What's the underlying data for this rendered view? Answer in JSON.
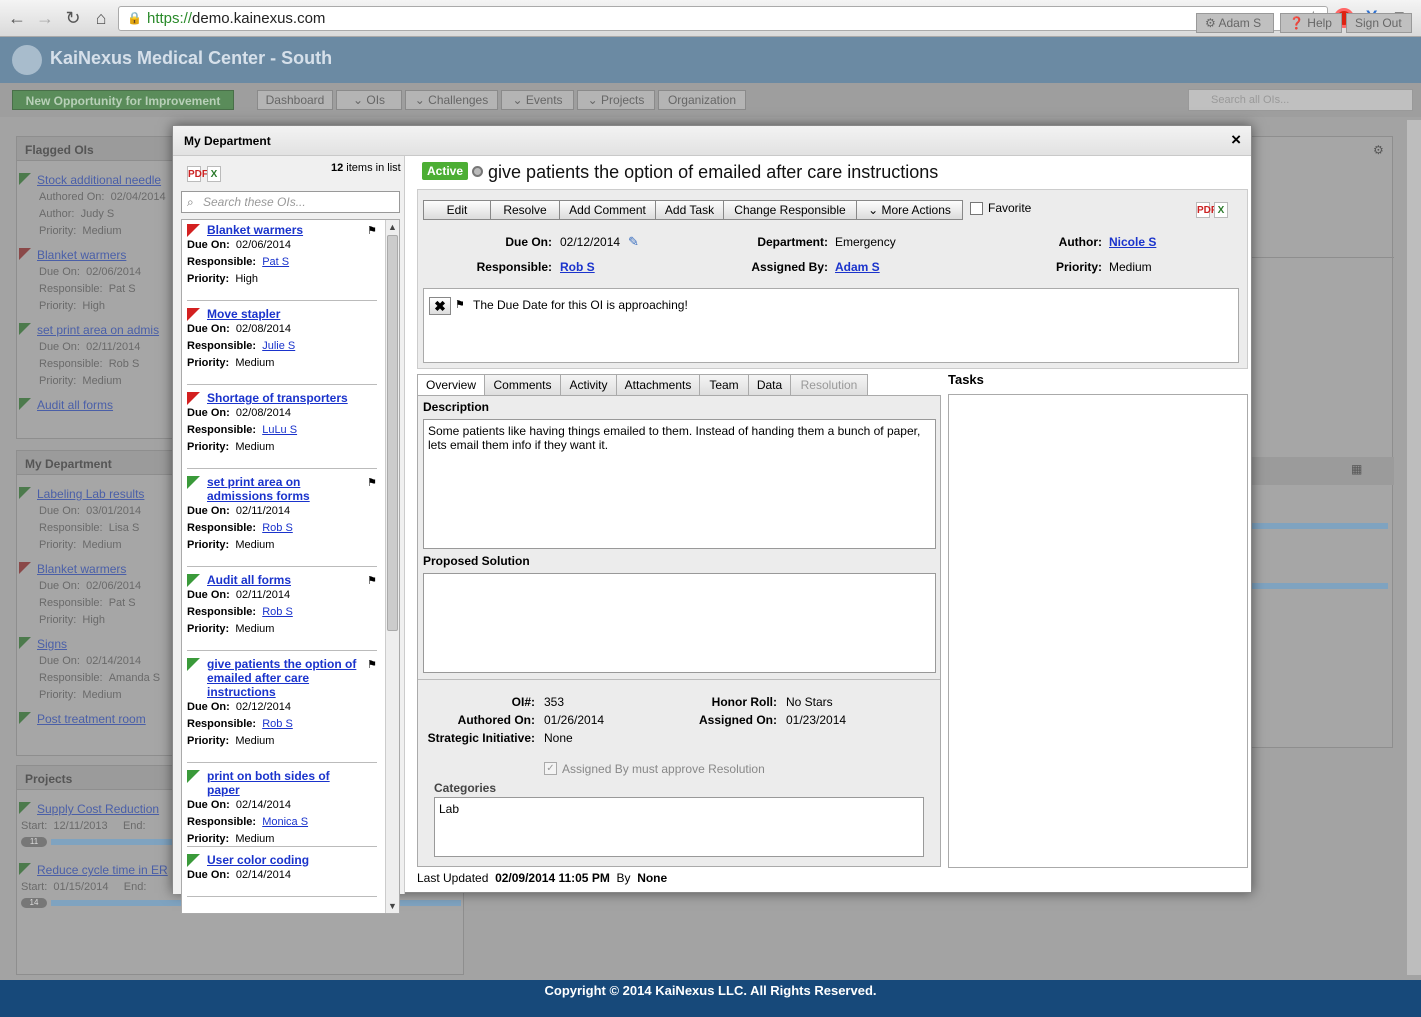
{
  "browser": {
    "url_scheme": "https://",
    "url_host": "demo.kainexus.com"
  },
  "app": {
    "title": "KaiNexus Medical Center - South",
    "header_buttons": [
      "Adam S",
      "Help",
      "Sign Out"
    ],
    "new_opp": "New Opportunity for Improvement",
    "nav_tabs": [
      "Dashboard",
      "OIs",
      "Challenges",
      "Events",
      "Projects",
      "Organization"
    ],
    "search_placeholder": "Search all OIs..."
  },
  "background": {
    "flagged_title": "Flagged OIs",
    "flagged": [
      {
        "title": "Stock additional needle",
        "l1": "Authored On:",
        "v1": "02/04/2014",
        "l2": "Author:",
        "v2": "Judy S",
        "l3": "Priority:",
        "v3": "Medium",
        "color": "green"
      },
      {
        "title": "Blanket warmers",
        "l1": "Due On:",
        "v1": "02/06/2014",
        "l2": "Responsible:",
        "v2": "Pat S",
        "l3": "Priority:",
        "v3": "High",
        "color": "red"
      },
      {
        "title": "set print area on admis",
        "l1": "Due On:",
        "v1": "02/11/2014",
        "l2": "Responsible:",
        "v2": "Rob S",
        "l3": "Priority:",
        "v3": "Medium",
        "color": "green"
      },
      {
        "title": "Audit all forms",
        "color": "green"
      }
    ],
    "mydept_title": "My Department",
    "mydept": [
      {
        "title": "Labeling Lab results",
        "l1": "Due On:",
        "v1": "03/01/2014",
        "l2": "Responsible:",
        "v2": "Lisa S",
        "l3": "Priority:",
        "v3": "Medium",
        "color": "green"
      },
      {
        "title": "Blanket warmers",
        "l1": "Due On:",
        "v1": "02/06/2014",
        "l2": "Responsible:",
        "v2": "Pat S",
        "l3": "Priority:",
        "v3": "High",
        "color": "red"
      },
      {
        "title": "Signs",
        "l1": "Due On:",
        "v1": "02/14/2014",
        "l2": "Responsible:",
        "v2": "Amanda S",
        "l3": "Priority:",
        "v3": "Medium",
        "color": "green"
      },
      {
        "title": "Post treatment room",
        "color": "green"
      }
    ],
    "projects_title": "Projects",
    "projects": [
      {
        "title": "Supply Cost Reduction",
        "start_label": "Start:",
        "start": "12/11/2013",
        "end_label": "End:",
        "badge": "11"
      },
      {
        "title": "Reduce cycle time in ER",
        "start_label": "Start:",
        "start": "01/15/2014",
        "end_label": "End:",
        "badge": "14"
      }
    ]
  },
  "modal": {
    "title": "My Department",
    "close": "×",
    "list": {
      "count": "12",
      "count_suffix": " items in list",
      "search_placeholder": "Search these OIs...",
      "items": [
        {
          "title": "Blanket warmers",
          "flag": "red",
          "pinned": true,
          "due": "02/06/2014",
          "responsible": "Pat S",
          "priority": "High"
        },
        {
          "title": "Move stapler",
          "flag": "red",
          "pinned": false,
          "due": "02/08/2014",
          "responsible": "Julie S",
          "priority": "Medium"
        },
        {
          "title": "Shortage of transporters",
          "flag": "red",
          "pinned": false,
          "due": "02/08/2014",
          "responsible": "LuLu S",
          "priority": "Medium"
        },
        {
          "title": "set print area on admissions forms",
          "flag": "green",
          "pinned": true,
          "due": "02/11/2014",
          "responsible": "Rob S",
          "priority": "Medium"
        },
        {
          "title": "Audit all forms",
          "flag": "green",
          "pinned": true,
          "due": "02/11/2014",
          "responsible": "Rob S",
          "priority": "Medium"
        },
        {
          "title": "give patients the option of emailed after care instructions",
          "flag": "green",
          "pinned": true,
          "due": "02/12/2014",
          "responsible": "Rob S",
          "priority": "Medium"
        },
        {
          "title": "print on both sides of paper",
          "flag": "green",
          "pinned": false,
          "due": "02/14/2014",
          "responsible": "Monica S",
          "priority": "Medium"
        },
        {
          "title": "User color coding",
          "flag": "green",
          "pinned": false,
          "due": "02/14/2014"
        }
      ],
      "labels": {
        "due": "Due On:",
        "responsible": "Responsible:",
        "priority": "Priority:"
      }
    },
    "detail": {
      "status": "Active",
      "title": "give patients the option of emailed after care instructions",
      "toolbar": [
        "Edit",
        "Resolve",
        "Add Comment",
        "Add Task",
        "Change Responsible",
        "More Actions"
      ],
      "favorite": "Favorite",
      "fields": {
        "due_on_label": "Due On:",
        "due_on": "02/12/2014",
        "responsible_label": "Responsible:",
        "responsible": "Rob S",
        "department_label": "Department:",
        "department": "Emergency",
        "assigned_by_label": "Assigned By:",
        "assigned_by": "Adam S",
        "author_label": "Author:",
        "author": "Nicole S",
        "priority_label": "Priority:",
        "priority": "Medium"
      },
      "alert": "The Due Date for this OI is approaching!",
      "tabs": [
        "Overview",
        "Comments",
        "Activity",
        "Attachments",
        "Team",
        "Data",
        "Resolution"
      ],
      "description_label": "Description",
      "description": "Some patients like having things emailed to them.  Instead of handing them a bunch of paper, lets email them info if they want it.",
      "proposed_label": "Proposed Solution",
      "proposed": "",
      "meta": {
        "oi_num_label": "OI#:",
        "oi_num": "353",
        "authored_on_label": "Authored On:",
        "authored_on": "01/26/2014",
        "strategic_label": "Strategic Initiative:",
        "strategic": "None",
        "honor_label": "Honor Roll:",
        "honor": "No Stars",
        "assigned_on_label": "Assigned On:",
        "assigned_on": "01/23/2014"
      },
      "approve_label": "Assigned By must approve Resolution",
      "categories_label": "Categories",
      "categories": "Lab",
      "tasks_label": "Tasks",
      "last_updated_label": "Last Updated",
      "last_updated": "02/09/2014 11:05 PM",
      "by_label": "By",
      "by": "None"
    }
  },
  "footer": "Copyright © 2014 KaiNexus LLC. All Rights Reserved."
}
